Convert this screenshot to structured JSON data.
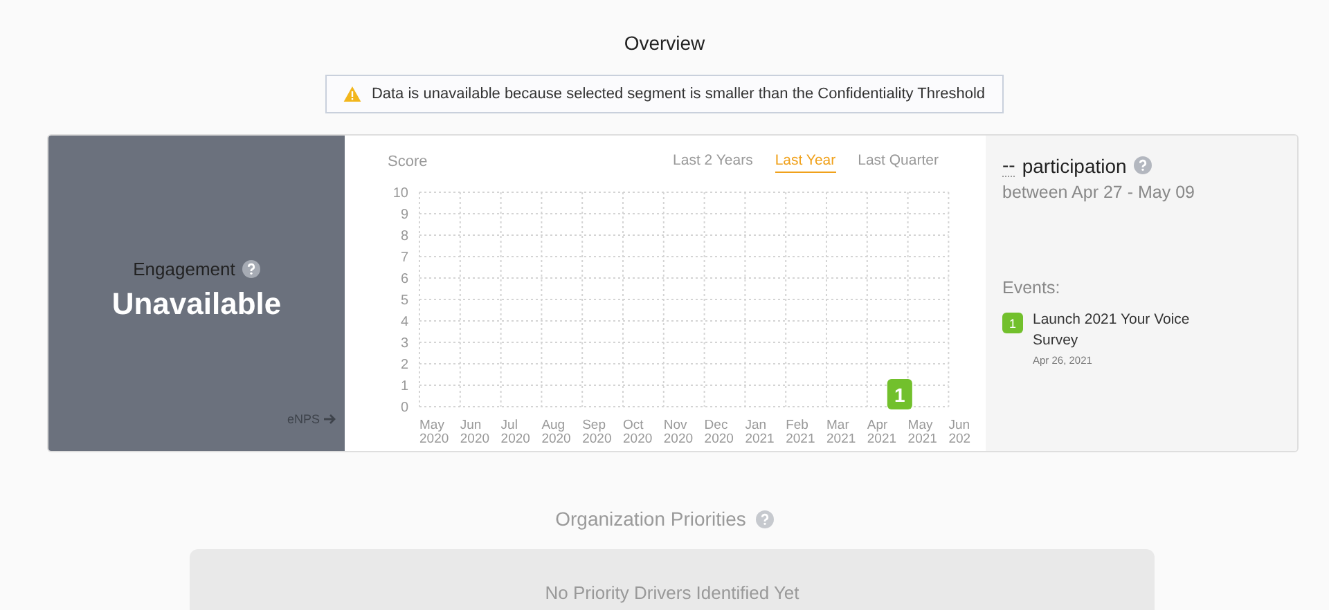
{
  "page_title": "Overview",
  "alert": {
    "text": "Data is unavailable because selected segment is smaller than the Confidentiality Threshold"
  },
  "engagement": {
    "label": "Engagement",
    "value": "Unavailable",
    "link": "eNPS"
  },
  "chart": {
    "title": "Score",
    "ranges": [
      {
        "label": "Last 2 Years",
        "selected": false
      },
      {
        "label": "Last Year",
        "selected": true
      },
      {
        "label": "Last Quarter",
        "selected": false
      }
    ],
    "y_ticks": [
      "10",
      "9",
      "8",
      "7",
      "6",
      "5",
      "4",
      "3",
      "2",
      "1",
      "0"
    ],
    "x_labels": [
      {
        "month": "May",
        "year": "2020"
      },
      {
        "month": "Jun",
        "year": "2020"
      },
      {
        "month": "Jul",
        "year": "2020"
      },
      {
        "month": "Aug",
        "year": "2020"
      },
      {
        "month": "Sep",
        "year": "2020"
      },
      {
        "month": "Oct",
        "year": "2020"
      },
      {
        "month": "Nov",
        "year": "2020"
      },
      {
        "month": "Dec",
        "year": "2020"
      },
      {
        "month": "Jan",
        "year": "2021"
      },
      {
        "month": "Feb",
        "year": "2021"
      },
      {
        "month": "Mar",
        "year": "2021"
      },
      {
        "month": "Apr",
        "year": "2021",
        "marker": "1"
      },
      {
        "month": "May",
        "year": "2021"
      },
      {
        "month": "Jun",
        "year": "202"
      }
    ]
  },
  "participation": {
    "value": "--",
    "label": "participation",
    "range": "between Apr 27 - May 09",
    "events_heading": "Events:",
    "events": [
      {
        "badge": "1",
        "title": "Launch 2021 Your Voice Survey",
        "date": "Apr 26, 2021"
      }
    ]
  },
  "priorities": {
    "title": "Organization Priorities",
    "empty_text": "No Priority Drivers Identified Yet"
  }
}
